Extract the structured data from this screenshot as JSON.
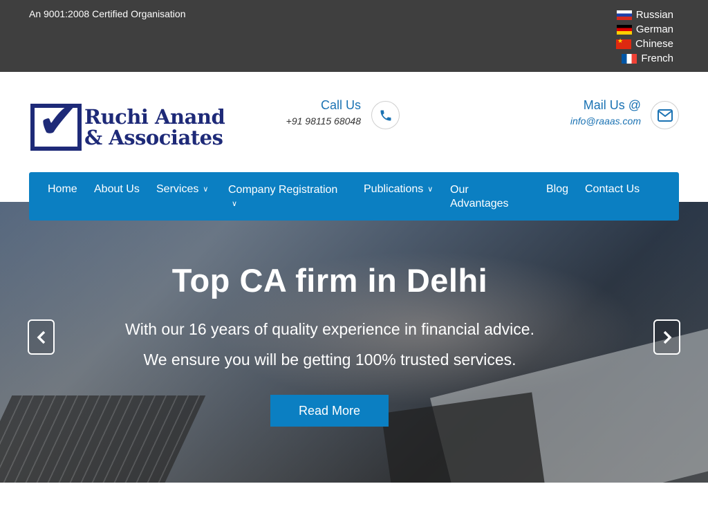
{
  "topbar": {
    "certification": "An 9001:2008 Certified Organisation",
    "languages": [
      {
        "label": "Russian",
        "flag": "russia-flag-icon"
      },
      {
        "label": "German",
        "flag": "germany-flag-icon"
      },
      {
        "label": "Chinese",
        "flag": "china-flag-icon"
      },
      {
        "label": "French",
        "flag": "france-flag-icon"
      }
    ]
  },
  "brand": {
    "line1": "Ruchi Anand",
    "line2": "& Associates",
    "color": "#1e2a78"
  },
  "contact": {
    "call_title": "Call Us",
    "call_number": "+91 98115 68048",
    "mail_title": "Mail Us @",
    "mail_address": "info@raaas.com",
    "accent": "#1a72b3"
  },
  "nav": {
    "bg_color": "#0b7fc2",
    "items": [
      {
        "label": "Home"
      },
      {
        "label": "About Us"
      },
      {
        "label": "Services",
        "has_dropdown": true
      },
      {
        "label": "Company Registration",
        "has_dropdown": true
      },
      {
        "label": "Publications",
        "has_dropdown": true
      },
      {
        "label": "Our Advantages"
      },
      {
        "label": "Blog"
      },
      {
        "label": "Contact Us"
      }
    ]
  },
  "hero": {
    "title": "Top CA firm in Delhi",
    "line1": "With our 16 years of quality experience in financial advice.",
    "line2": "We ensure you will be getting 100% trusted services.",
    "cta": "Read More",
    "prev_icon": "chevron-left-icon",
    "next_icon": "chevron-right-icon"
  }
}
